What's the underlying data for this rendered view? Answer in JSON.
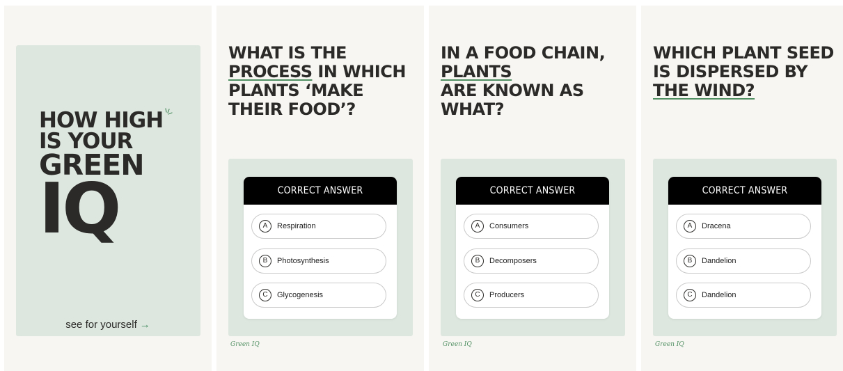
{
  "cover": {
    "line1": "HOW HIGH",
    "line2": "IS YOUR",
    "line3": "GREEN",
    "line4": "IQ",
    "cta": "see for yourself",
    "cta_arrow": "→"
  },
  "quiz_header": "CORRECT ANSWER",
  "brand": "Green IQ",
  "accent_color": "#4f8f62",
  "questions": [
    {
      "title_pre": "WHAT IS THE",
      "title_hl": "PROCESS",
      "title_post": "IN WHICH PLANTS ‘MAKE THEIR FOOD’?",
      "options": [
        {
          "letter": "A",
          "text": "Respiration"
        },
        {
          "letter": "B",
          "text": "Photosynthesis"
        },
        {
          "letter": "C",
          "text": "Glycogenesis"
        }
      ]
    },
    {
      "title_pre": "IN A FOOD CHAIN,",
      "title_hl": "PLANTS",
      "title_post": "ARE KNOWN AS WHAT?",
      "options": [
        {
          "letter": "A",
          "text": "Consumers"
        },
        {
          "letter": "B",
          "text": "Decomposers"
        },
        {
          "letter": "C",
          "text": "Producers"
        }
      ]
    },
    {
      "title_pre": "WHICH PLANT SEED IS DISPERSED BY",
      "title_hl": "THE WIND?",
      "title_post": "",
      "options": [
        {
          "letter": "A",
          "text": "Dracena"
        },
        {
          "letter": "B",
          "text": "Dandelion"
        },
        {
          "letter": "C",
          "text": "Dandelion"
        }
      ]
    }
  ]
}
